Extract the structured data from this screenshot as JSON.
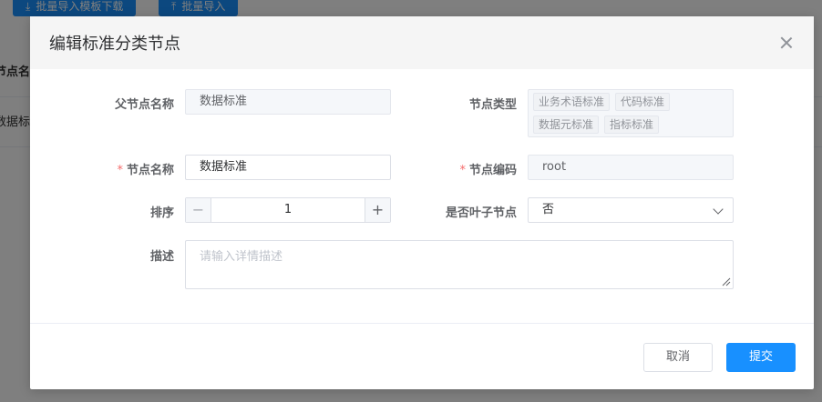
{
  "background": {
    "toolbar": {
      "download_template_label": "批量导入模板下载",
      "batch_import_label": "批量导入"
    },
    "table": {
      "header_cell": "节点名称",
      "row_cell": "数据标准"
    }
  },
  "dialog": {
    "title": "编辑标准分类节点",
    "fields": {
      "parent_name": {
        "label": "父节点名称",
        "value": "数据标准"
      },
      "node_type": {
        "label": "节点类型",
        "tags": [
          "业务术语标准",
          "代码标准",
          "数据元标准",
          "指标标准"
        ]
      },
      "node_name": {
        "label": "节点名称",
        "value": "数据标准",
        "required_mark": "*"
      },
      "node_code": {
        "label": "节点编码",
        "value": "root",
        "required_mark": "*"
      },
      "sort": {
        "label": "排序",
        "value": "1",
        "minus": "−",
        "plus": "+"
      },
      "is_leaf": {
        "label": "是否叶子节点",
        "value": "否"
      },
      "description": {
        "label": "描述",
        "placeholder": "请输入详情描述"
      }
    },
    "footer": {
      "cancel_label": "取消",
      "submit_label": "提交"
    }
  },
  "colors": {
    "primary": "#1890ff",
    "required": "#f56c6c",
    "overlay": "rgba(0,0,0,0.5)"
  },
  "icons": [
    "download-icon",
    "upload-icon",
    "close-icon",
    "chevron-down-icon",
    "resize-handle-icon"
  ]
}
